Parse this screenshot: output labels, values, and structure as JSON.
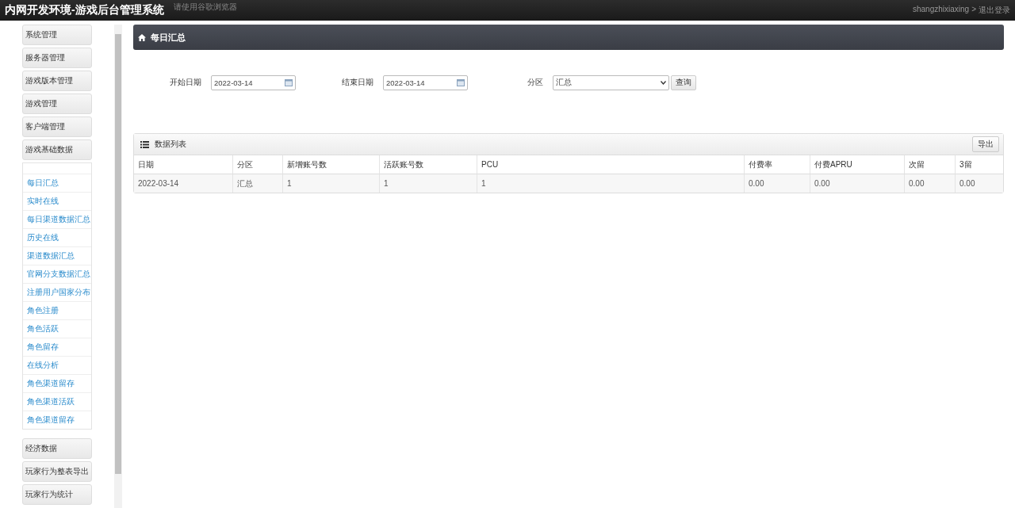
{
  "header": {
    "title": "内网开发环境-游戏后台管理系统",
    "notice": "请使用谷歌浏览器",
    "user": "shangzhixiaxing",
    "separator": ">",
    "logout": "退出登录"
  },
  "sidebar": {
    "menus": [
      {
        "label": "系统管理"
      },
      {
        "label": "服务器管理"
      },
      {
        "label": "游戏版本管理"
      },
      {
        "label": "游戏管理"
      },
      {
        "label": "客户端管理"
      },
      {
        "label": "游戏基础数据",
        "children": [
          "每日汇总",
          "实时在线",
          "每日渠道数据汇总",
          "历史在线",
          "渠道数据汇总",
          "官网分支数据汇总",
          "注册用户国家分布",
          "角色注册",
          "角色活跃",
          "角色留存",
          "在线分析",
          "角色渠道留存",
          "角色渠道活跃",
          "角色渠道留存"
        ]
      },
      {
        "label": "经济数据"
      },
      {
        "label": "玩家行为整表导出"
      },
      {
        "label": "玩家行为统计"
      }
    ]
  },
  "page_title": "每日汇总",
  "filters": [
    {
      "kind": "date",
      "label": "开始日期",
      "value": "2022-03-14"
    },
    {
      "kind": "date",
      "label": "结束日期",
      "value": "2022-03-14"
    },
    {
      "kind": "select",
      "label": "分区",
      "value": "汇总"
    }
  ],
  "query_button": "查询",
  "table": {
    "title": "数据列表",
    "export_button": "导出",
    "columns": [
      "日期",
      "分区",
      "新增账号数",
      "活跃账号数",
      "PCU",
      "付费率",
      "付费APRU",
      "次留",
      "3留"
    ],
    "rows": [
      [
        "2022-03-14",
        "汇总",
        "1",
        "1",
        "1",
        "0.00",
        "0.00",
        "0.00",
        "0.00"
      ]
    ]
  }
}
